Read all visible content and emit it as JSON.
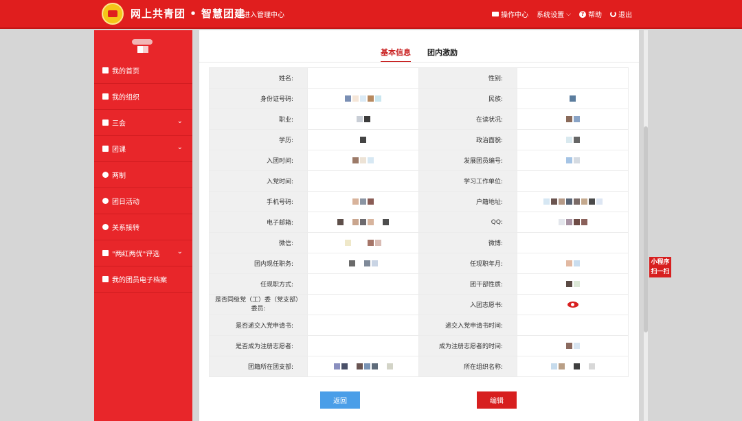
{
  "header": {
    "title": "网上共青团 • 智慧团建",
    "admin_link": "进入管理中心",
    "nav": {
      "ops": "操作中心",
      "settings": "系统设置",
      "help": "帮助",
      "logout": "退出"
    }
  },
  "sidebar": {
    "items": [
      {
        "label": "我的首页",
        "icon": "home-icon"
      },
      {
        "label": "我的组织",
        "icon": "users-icon"
      },
      {
        "label": "三会",
        "icon": "checkbox-icon"
      },
      {
        "label": "团课",
        "icon": "folder-icon"
      },
      {
        "label": "两制",
        "icon": "circle-icon"
      },
      {
        "label": "团日活动",
        "icon": "recycle-icon"
      },
      {
        "label": "关系接转",
        "icon": "refresh-icon"
      },
      {
        "label": "\"两红两优\"评选",
        "icon": "checkbox-icon"
      },
      {
        "label": "我的团员电子档案",
        "icon": "file-icon"
      }
    ]
  },
  "tabs": {
    "basic": "基本信息",
    "incentive": "团内激励"
  },
  "info": {
    "rows": [
      [
        "姓名:",
        "性别:"
      ],
      [
        "身份证号码:",
        "民族:"
      ],
      [
        "职业:",
        "在读状况:"
      ],
      [
        "学历:",
        "政治面貌:"
      ],
      [
        "入团时间:",
        "发展团员编号:"
      ],
      [
        "入党时间:",
        "学习工作单位:"
      ],
      [
        "手机号码:",
        "户籍地址:"
      ],
      [
        "电子邮箱:",
        "QQ:"
      ],
      [
        "微信:",
        "微博:"
      ],
      [
        "团内现任职务:",
        "任现职年月:"
      ],
      [
        "任现职方式:",
        "团干部性质:"
      ],
      [
        "是否同级党（工）委（党支部）委员:",
        "入团志愿书:"
      ],
      [
        "是否递交入党申请书:",
        "递交入党申请书时间:"
      ],
      [
        "是否成为注册志愿者:",
        "成为注册志愿者的时间:"
      ],
      [
        "团籍所在团支部:",
        "所在组织名称:"
      ]
    ]
  },
  "buttons": {
    "back": "返回",
    "edit": "编辑"
  },
  "float_badge": {
    "line1": "小程序",
    "line2": "扫一扫"
  },
  "colors": {
    "brand_red": "#e01e1e",
    "sidebar_red": "#e8262a",
    "back_blue": "#4a9ee8"
  }
}
